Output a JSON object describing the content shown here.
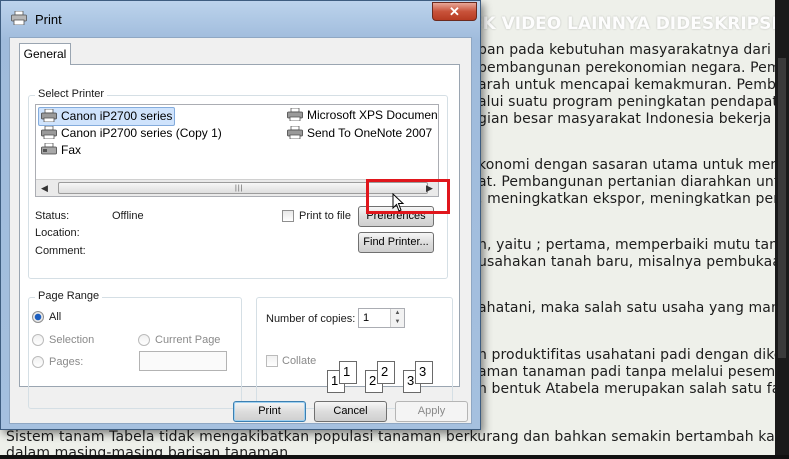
{
  "background": {
    "banner": "<< CEK VIDEO LAINNYA DIDESKRIPSI",
    "lines": [
      "pan pada kebutuhan masyarakatnya dari sekt",
      "pembangunan perekonomian negara. Pembang",
      "arah untuk mencapai kemakmuran. Pembangu",
      "alui suatu program peningkatan pendapatan p",
      "gian besar masyarakat Indonesia bekerja di s",
      "konomi dengan sasaran utama untuk mencapa",
      "at. Pembangunan pertanian diarahkan untuk m",
      ", meningkatkan ekspor, meningkatkan pendapa",
      "n, yaitu ; pertama, memperbaiki mutu tanah y",
      "usahakan tanah baru, misalnya pembukaan p",
      "ahatani, maka salah satu usaha yang mampu",
      "n produktifitas usahatani padi dengan dikemb",
      "aman tanaman padi tanpa melalui pesemaian",
      "n bentuk Atabela merupakan salah satu fakt",
      "Sistem tanam Tabela tidak mengakibatkan populasi tanaman berkurang dan bahkan semakin bertambah karena adany",
      "dalam masing-masing barisan tanaman."
    ]
  },
  "dialog": {
    "title": "Print",
    "close_symbol": "✕",
    "tab_label": "General",
    "select_printer": {
      "group_label": "Select Printer",
      "printers": [
        {
          "name": "Canon iP2700 series",
          "icon": "printer-icon",
          "selected": true
        },
        {
          "name": "Canon iP2700 series (Copy 1)",
          "icon": "printer-icon"
        },
        {
          "name": "Fax",
          "icon": "fax-icon"
        },
        {
          "name": "Microsoft XPS Documen",
          "icon": "printer-icon"
        },
        {
          "name": "Send To OneNote 2007",
          "icon": "printer-icon"
        }
      ],
      "scroll_left": "◀",
      "scroll_right": "▶",
      "scroll_grip": "|||",
      "status_label": "Status:",
      "status_value": "Offline",
      "location_label": "Location:",
      "comment_label": "Comment:",
      "print_to_file": "Print to file",
      "preferences_button": "Preferences",
      "find_printer_button": "Find Printer..."
    },
    "page_range": {
      "group_label": "Page Range",
      "all": "All",
      "selection": "Selection",
      "current_page": "Current Page",
      "pages": "Pages:"
    },
    "copies": {
      "number_label": "Number of copies:",
      "number_value": "1",
      "collate": "Collate",
      "collate_digits": [
        "1",
        "1",
        "2",
        "2",
        "3",
        "3"
      ]
    },
    "buttons": {
      "print": "Print",
      "cancel": "Cancel",
      "apply": "Apply"
    }
  },
  "colors": {
    "highlight": "#e0161c",
    "dialog_frame": "#a9c4e2",
    "selected_item": "#cfe3fc"
  }
}
